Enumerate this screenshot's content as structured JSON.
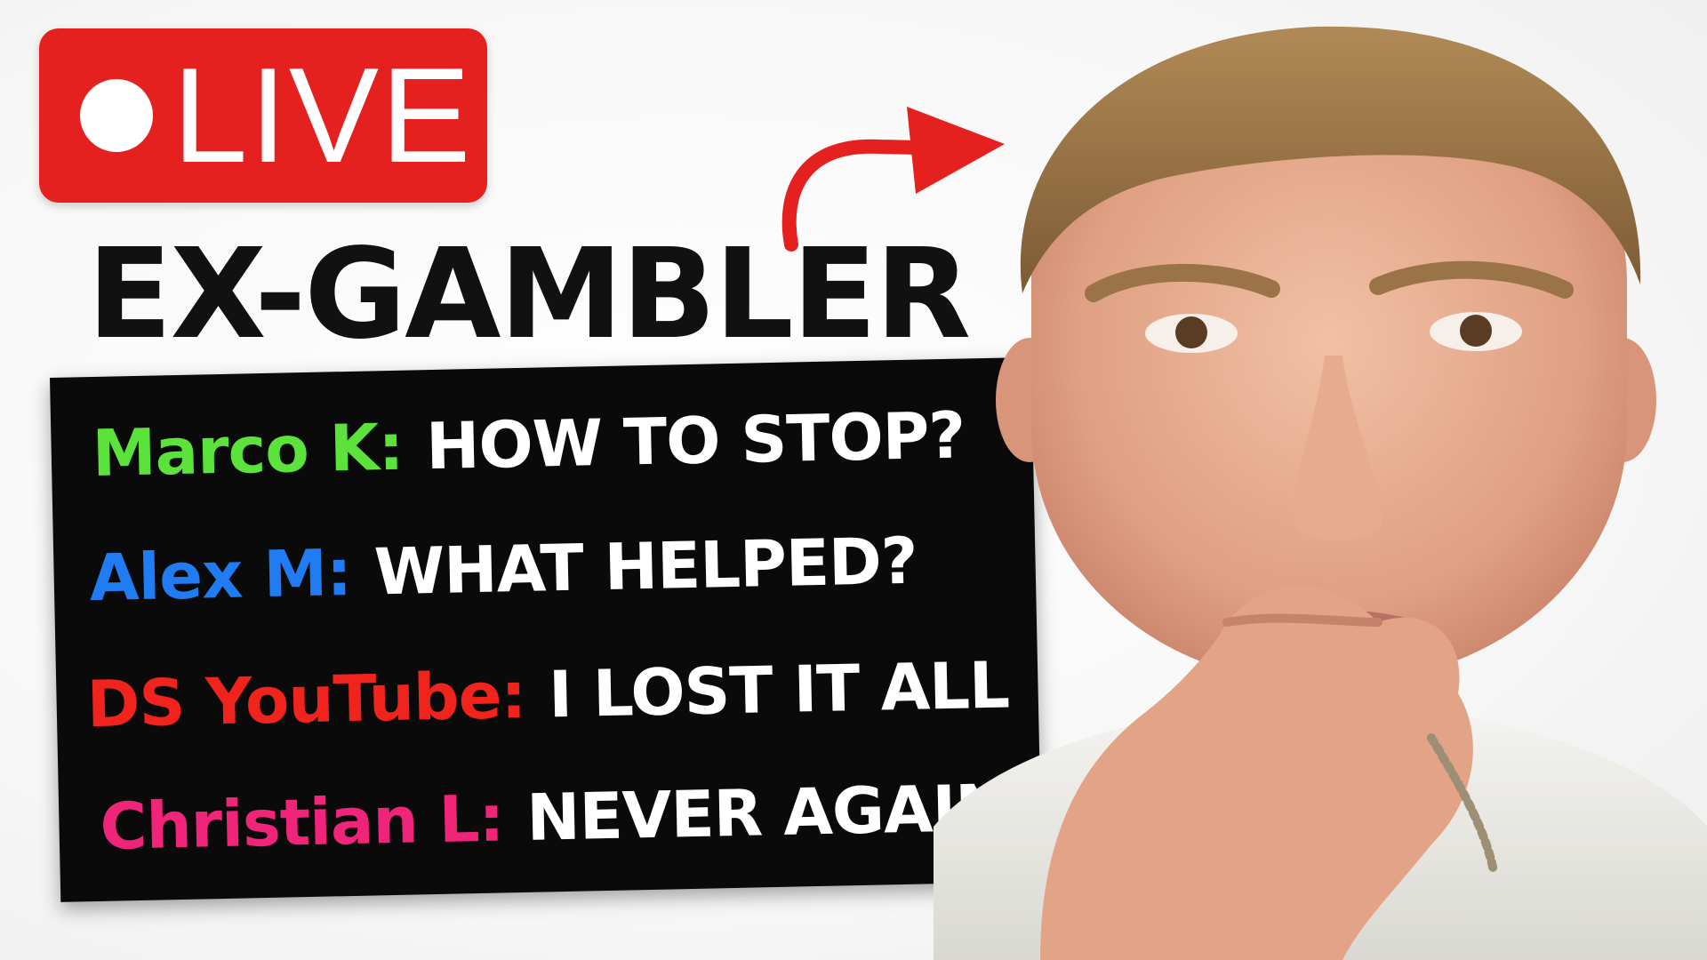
{
  "badge": {
    "label": "LIVE",
    "color": "#e5211f"
  },
  "headline": "EX-GAMBLER",
  "chat": [
    {
      "name": "Marco K:",
      "message": "HOW TO STOP?",
      "color": "#5be33c"
    },
    {
      "name": "Alex M:",
      "message": "WHAT HELPED?",
      "color": "#1f7cf2"
    },
    {
      "name": "DS YouTube:",
      "message": "I LOST IT ALL",
      "color": "#f0241c"
    },
    {
      "name": "Christian L:",
      "message": "NEVER AGAIN",
      "color": "#f0257a"
    }
  ],
  "arrow": {
    "color": "#e5211f",
    "icon": "curved-arrow-right-icon"
  },
  "person": {
    "icon": "man-thinking-hand-on-chin"
  }
}
